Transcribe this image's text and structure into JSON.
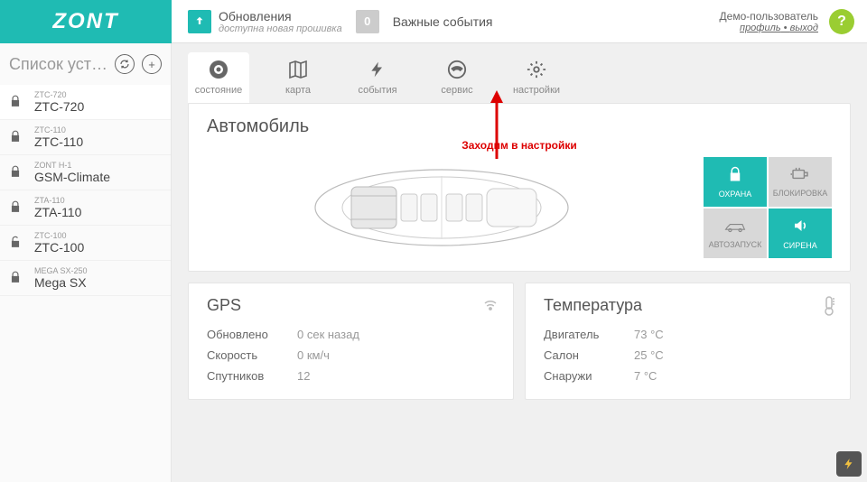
{
  "logo": "ZONT",
  "header": {
    "updates_title": "Обновления",
    "updates_sub": "доступна новая прошивка",
    "events_count": "0",
    "events_label": "Важные события",
    "user": "Демо-пользователь",
    "profile_link": "профиль",
    "logout_link": "выход",
    "help": "?"
  },
  "sidebar": {
    "title": "Список устро...",
    "items": [
      {
        "sub": "ZTC-720",
        "label": "ZTC-720",
        "locked": true,
        "selected": true
      },
      {
        "sub": "ZTC-110",
        "label": "ZTC-110",
        "locked": true,
        "selected": false
      },
      {
        "sub": "ZONT H-1",
        "label": "GSM-Climate",
        "locked": true,
        "selected": false
      },
      {
        "sub": "ZTA-110",
        "label": "ZTA-110",
        "locked": true,
        "selected": false
      },
      {
        "sub": "ZTC-100",
        "label": "ZTC-100",
        "locked": false,
        "selected": false
      },
      {
        "sub": "MEGA SX-250",
        "label": "Mega SX",
        "locked": true,
        "selected": false
      }
    ]
  },
  "tabs": [
    {
      "key": "state",
      "label": "состояние",
      "active": true
    },
    {
      "key": "map",
      "label": "карта",
      "active": false
    },
    {
      "key": "events",
      "label": "события",
      "active": false
    },
    {
      "key": "service",
      "label": "сервис",
      "active": false
    },
    {
      "key": "settings",
      "label": "настройки",
      "active": false
    }
  ],
  "car": {
    "title": "Автомобиль",
    "annotation": "Заходим в настройки",
    "buttons": [
      {
        "label": "ОХРАНА",
        "style": "teal",
        "icon": "lock"
      },
      {
        "label": "БЛОКИРОВКА",
        "style": "gray",
        "icon": "engine"
      },
      {
        "label": "АВТОЗАПУСК",
        "style": "gray",
        "icon": "car"
      },
      {
        "label": "СИРЕНА",
        "style": "teal",
        "icon": "siren"
      }
    ]
  },
  "gps": {
    "title": "GPS",
    "rows": [
      {
        "k": "Обновлено",
        "v": "0 сек назад"
      },
      {
        "k": "Скорость",
        "v": "0 км/ч"
      },
      {
        "k": "Спутников",
        "v": "12"
      }
    ]
  },
  "temp": {
    "title": "Температура",
    "rows": [
      {
        "k": "Двигатель",
        "v": "73 °C"
      },
      {
        "k": "Салон",
        "v": "25 °C"
      },
      {
        "k": "Снаружи",
        "v": "7 °C"
      }
    ]
  }
}
